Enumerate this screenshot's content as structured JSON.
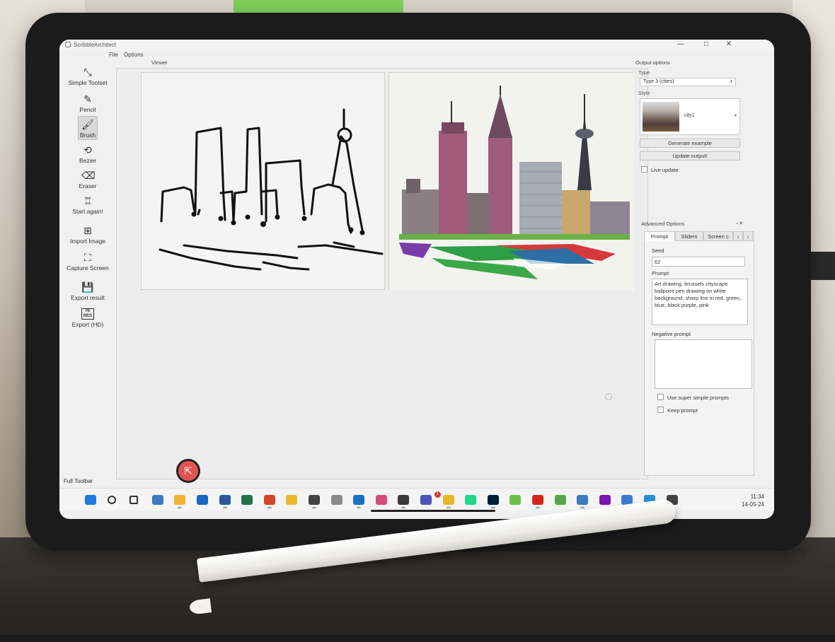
{
  "window": {
    "title": "ScribbleArchitect",
    "minimize": "—",
    "maximize": "□",
    "close": "✕"
  },
  "menu": {
    "file": "File",
    "options": "Options"
  },
  "toolbar": {
    "simple_toolset": "Simple Toolset",
    "pencil": "Pencil",
    "brush": "Brush",
    "bezier": "Bezier",
    "eraser": "Eraser",
    "start_again": "Start again!",
    "import_image": "Import Image",
    "capture_screen": "Capture Screen",
    "export_result": "Export result",
    "export_hd": "Export (HD)",
    "export_hd_icon_text": "HI RES"
  },
  "viewer": {
    "label": "Viewer"
  },
  "output_options": {
    "title": "Output options",
    "type_label": "Type",
    "type_value": "Type 3 (cities)",
    "style_label": "Style",
    "style_value": "city1",
    "generate_example": "Generate example",
    "update_output": "Update output!",
    "live_update": "Live update"
  },
  "advanced_options": {
    "title": "Advanced Options",
    "tabs": [
      "Prompt",
      "Sliders",
      "Screen c"
    ],
    "seed_label": "Seed",
    "seed_value": "62",
    "prompt_label": "Prompt",
    "prompt_value": "Art drawing, brussels cityscape ballpoint pen drawing on white background, sharp line in red, green, blue, black purple, pink",
    "negative_prompt_label": "Negative prompt",
    "negative_prompt_value": "",
    "super_simple": "Use super simple prompts",
    "keep_prompt": "Keep prompt"
  },
  "status": {
    "text": "Full Toolbar"
  },
  "taskbar": {
    "time": "11:34",
    "date": "14-05-24",
    "teams_badge": "1",
    "icons": [
      {
        "name": "start-icon",
        "color": "#1f7ae0"
      },
      {
        "name": "search-icon",
        "color": "#333333"
      },
      {
        "name": "task-view-icon",
        "color": "#333333"
      },
      {
        "name": "remote-desktop-icon",
        "color": "#3b7bbf"
      },
      {
        "name": "file-explorer-icon",
        "color": "#f2b233"
      },
      {
        "name": "outlook-icon",
        "color": "#1967c0"
      },
      {
        "name": "word-icon",
        "color": "#2b579a"
      },
      {
        "name": "excel-icon",
        "color": "#217346"
      },
      {
        "name": "powerpoint-icon",
        "color": "#d24726"
      },
      {
        "name": "chrome-icon",
        "color": "#e8b72a"
      },
      {
        "name": "davinci-icon",
        "color": "#444444"
      },
      {
        "name": "sig-icon",
        "color": "#8a8a8a"
      },
      {
        "name": "vpn-icon",
        "color": "#1c6fc4"
      },
      {
        "name": "snipping-icon",
        "color": "#d84c7d"
      },
      {
        "name": "sticky-notes-icon",
        "color": "#3a3a3a"
      },
      {
        "name": "teams-icon",
        "color": "#4b53bc"
      },
      {
        "name": "chrome-profile-icon",
        "color": "#e8b72a"
      },
      {
        "name": "pycharm-icon",
        "color": "#21d789"
      },
      {
        "name": "photoshop-icon",
        "color": "#001e36"
      },
      {
        "name": "green-app-icon",
        "color": "#6cc04a"
      },
      {
        "name": "acrobat-icon",
        "color": "#d4251c"
      },
      {
        "name": "paint-icon",
        "color": "#5aa64f"
      },
      {
        "name": "network-icon",
        "color": "#3b7bbf"
      },
      {
        "name": "onenote-icon",
        "color": "#7719aa"
      },
      {
        "name": "notepad-icon",
        "color": "#3d7dd0"
      },
      {
        "name": "photos-icon",
        "color": "#2d8bd6"
      },
      {
        "name": "scribble-app-icon",
        "color": "#444444"
      }
    ]
  }
}
